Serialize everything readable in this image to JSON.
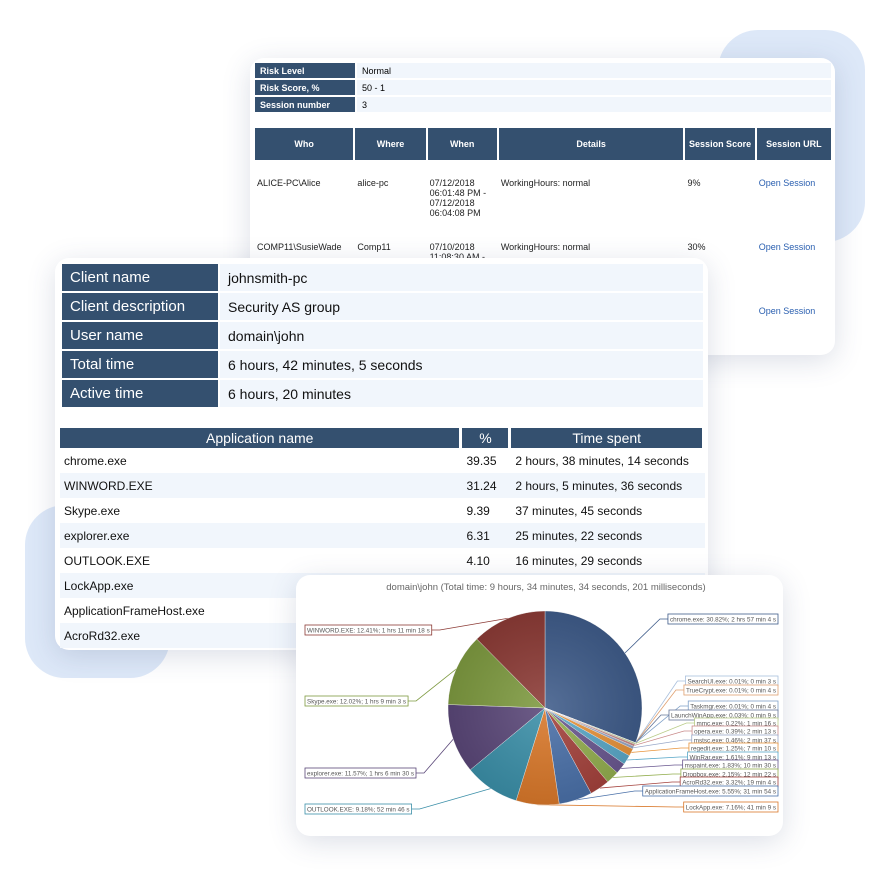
{
  "risk_card": {
    "info": [
      {
        "label": "Risk Level",
        "value": "Normal"
      },
      {
        "label": "Risk Score, %",
        "value": "50 - 1"
      },
      {
        "label": "Session number",
        "value": "3"
      }
    ],
    "columns": [
      "Who",
      "Where",
      "When",
      "Details",
      "Session Score",
      "Session URL"
    ],
    "rows": [
      {
        "who": "ALICE-PC\\Alice",
        "where": "alice-pc",
        "when": "07/12/2018 06:01:48 PM - 07/12/2018 06:04:08 PM",
        "details": "WorkingHours: normal",
        "score": "9%",
        "url": "Open Session"
      },
      {
        "who": "COMP11\\SusieWade",
        "where": "Comp11",
        "when": "07/10/2018 11:08:30 AM -",
        "details": "WorkingHours: normal",
        "score": "30%",
        "url": "Open Session"
      },
      {
        "who": "",
        "where": "",
        "when": "",
        "details": "",
        "score": "",
        "url": "Open Session"
      }
    ]
  },
  "client_card": {
    "info": [
      {
        "label": "Client name",
        "value": "johnsmith-pc"
      },
      {
        "label": "Client description",
        "value": "Security AS group"
      },
      {
        "label": "User name",
        "value": "domain\\john"
      },
      {
        "label": "Total time",
        "value": "6 hours, 42 minutes, 5 seconds"
      },
      {
        "label": "Active time",
        "value": "6 hours, 20 minutes"
      }
    ],
    "columns": [
      "Application name",
      "%",
      "Time spent"
    ],
    "rows": [
      {
        "app": "chrome.exe",
        "pct": "39.35",
        "time": "2 hours, 38 minutes, 14 seconds"
      },
      {
        "app": "WINWORD.EXE",
        "pct": "31.24",
        "time": "2 hours, 5 minutes, 36 seconds"
      },
      {
        "app": "Skype.exe",
        "pct": "9.39",
        "time": "37 minutes, 45 seconds"
      },
      {
        "app": "explorer.exe",
        "pct": "6.31",
        "time": "25 minutes, 22 seconds"
      },
      {
        "app": "OUTLOOK.EXE",
        "pct": "4.10",
        "time": "16 minutes, 29 seconds"
      },
      {
        "app": "LockApp.exe",
        "pct": "",
        "time": ""
      },
      {
        "app": "ApplicationFrameHost.exe",
        "pct": "",
        "time": ""
      },
      {
        "app": "AcroRd32.exe",
        "pct": "",
        "time": ""
      }
    ]
  },
  "chart_data": {
    "type": "pie",
    "title": "domain\\john (Total time: 9 hours, 34 minutes, 34 seconds, 201 milliseconds)",
    "slices": [
      {
        "name": "chrome.exe",
        "value": 30.82,
        "label": "chrome.exe: 30.82%; 2 hrs 57 min 4 s",
        "color": "#3f5c8a"
      },
      {
        "name": "SearchUI.exe",
        "value": 0.01,
        "label": "SearchUI.exe: 0.01%; 0 min 3 s",
        "color": "#a9c0dd"
      },
      {
        "name": "TrueCrypt.exe",
        "value": 0.01,
        "label": "TrueCrypt.exe: 0.01%; 0 min 4 s",
        "color": "#e0a070"
      },
      {
        "name": "Taskmgr.exe",
        "value": 0.01,
        "label": "Taskmgr.exe: 0.01%; 0 min 4 s",
        "color": "#7fa0c8"
      },
      {
        "name": "LaunchWinApp.exe",
        "value": 0.03,
        "label": "LaunchWinApp.exe: 0.03%; 0 min 9 s",
        "color": "#667799"
      },
      {
        "name": "mmc.exe",
        "value": 0.22,
        "label": "mmc.exe: 0.22%; 1 min 16 s",
        "color": "#b9cc88"
      },
      {
        "name": "opera.exe",
        "value": 0.39,
        "label": "opera.exe: 0.39%; 2 min 13 s",
        "color": "#c98a8a"
      },
      {
        "name": "mstsc.exe",
        "value": 0.46,
        "label": "mstsc.exe: 0.46%; 2 min 37 s",
        "color": "#98a8c8"
      },
      {
        "name": "regedit.exe",
        "value": 1.25,
        "label": "regedit.exe: 1.25%; 7 min 10 s",
        "color": "#e8943c"
      },
      {
        "name": "WinRar.exe",
        "value": 1.61,
        "label": "WinRar.exe: 1.61%; 9 min 13 s",
        "color": "#5aa8c8"
      },
      {
        "name": "mspaint.exe",
        "value": 1.83,
        "label": "mspaint.exe: 1.83%; 10 min 30 s",
        "color": "#6a5890"
      },
      {
        "name": "Dropbox.exe",
        "value": 2.15,
        "label": "Dropbox.exe: 2.15%; 12 min 22 s",
        "color": "#93ae4f"
      },
      {
        "name": "AcroRd32.exe",
        "value": 3.32,
        "label": "AcroRd32.exe: 3.32%; 19 min 4 s",
        "color": "#a4423c"
      },
      {
        "name": "ApplicationFrameHost.exe",
        "value": 5.55,
        "label": "ApplicationFrameHost.exe: 5.55%; 31 min 54 s",
        "color": "#4a70a8"
      },
      {
        "name": "LockApp.exe",
        "value": 7.16,
        "label": "LockApp.exe: 7.16%; 41 min 9 s",
        "color": "#d9782a"
      },
      {
        "name": "OUTLOOK.EXE",
        "value": 9.18,
        "label": "OUTLOOK.EXE: 9.18%; 52 min 46 s",
        "color": "#3b8fa8"
      },
      {
        "name": "explorer.exe",
        "value": 11.57,
        "label": "explorer.exe: 11.57%; 1 hrs 6 min 30 s",
        "color": "#5a4778"
      },
      {
        "name": "Skype.exe",
        "value": 12.02,
        "label": "Skype.exe: 12.02%; 1 hrs 9 min 3 s",
        "color": "#7e9a40"
      },
      {
        "name": "WINWORD.EXE",
        "value": 12.41,
        "label": "WINWORD.EXE: 12.41%; 1 hrs 11 min 18 s",
        "color": "#8c3b36"
      }
    ]
  }
}
